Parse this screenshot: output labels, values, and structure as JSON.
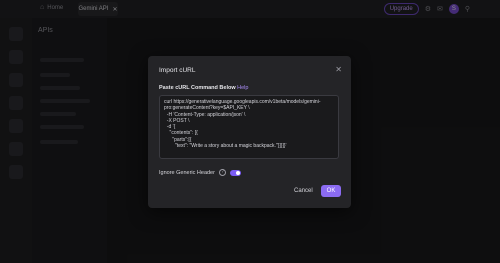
{
  "topbar": {
    "home_label": "Home",
    "tab_label": "Gemini API",
    "upgrade_label": "Upgrade",
    "avatar_letter": "S"
  },
  "sidebar": {
    "title": "APIs"
  },
  "modal": {
    "title": "Import cURL",
    "paste_label": "Paste cURL Command Below",
    "help_label": "Help",
    "code_lines": [
      "curl https://generativelanguage.googleapis.com/v1beta/models/gemini-",
      "pro:generateContent?key=$API_KEY \\",
      "  -H 'Content-Type: application/json' \\",
      "  -X POST \\",
      "  -d '{",
      "    \"contents\": [{",
      "      \"parts\":[{",
      "        \"text\": \"Write a story about a magic backpack.\"}]}]}'"
    ],
    "toggle_label": "Ignore Generic Header",
    "toggle_on": true,
    "cancel_label": "Cancel",
    "ok_label": "OK"
  },
  "colors": {
    "accent": "#8b6bf2",
    "background": "#1b1b1d",
    "modal_bg": "#242427"
  }
}
